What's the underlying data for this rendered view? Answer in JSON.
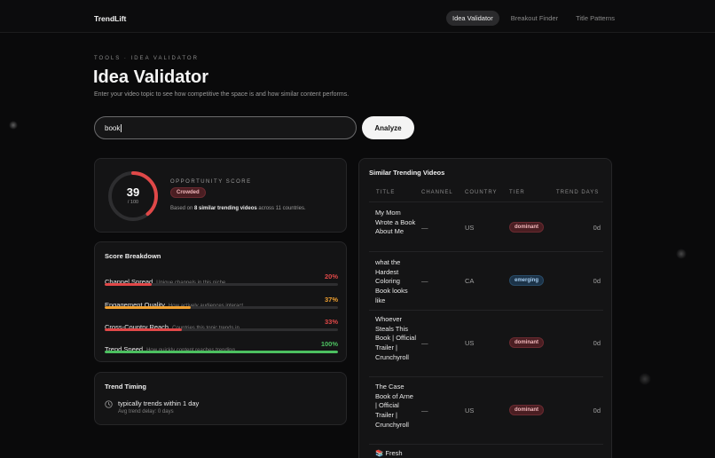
{
  "app": {
    "brand": "TrendLift"
  },
  "nav": {
    "items": [
      "Idea Validator",
      "Breakout Finder",
      "Title Patterns"
    ]
  },
  "header": {
    "breadcrumb": "TOOLS · IDEA VALIDATOR",
    "title": "Idea Validator",
    "subtitle": "Enter your video topic to see how competitive the space is and how similar content performs."
  },
  "search": {
    "value": "book",
    "button_label": "Analyze"
  },
  "score": {
    "value": 39,
    "denominator": "/ 100",
    "label": "OPPORTUNITY SCORE",
    "status": "Crowded",
    "based_prefix": "Based on ",
    "based_bold": "8 similar trending videos",
    "based_suffix": " across 11 countries.",
    "color": "#e04848"
  },
  "breakdown": {
    "title": "Score Breakdown",
    "metrics": [
      {
        "name": "Channel Spread",
        "desc": "Unique channels in this niche",
        "pct": "20%",
        "fraction": 0.2,
        "color": "#e04848"
      },
      {
        "name": "Engagement Quality",
        "desc": "How actively audiences interact",
        "pct": "37%",
        "fraction": 0.37,
        "color": "#f0a030"
      },
      {
        "name": "Cross-Country Reach",
        "desc": "Countries this topic trends in",
        "pct": "33%",
        "fraction": 0.33,
        "color": "#e04848"
      },
      {
        "name": "Trend Speed",
        "desc": "How quickly content reaches trending",
        "pct": "100%",
        "fraction": 1.0,
        "color": "#4cc060"
      }
    ]
  },
  "timing": {
    "title": "Trend Timing",
    "main": "typically trends within 1 day",
    "sub": "Avg trend delay: 0 days"
  },
  "similar": {
    "title": "Similar Trending Videos",
    "columns": [
      "TITLE",
      "CHANNEL",
      "COUNTRY",
      "TIER",
      "TREND DAYS"
    ],
    "rows": [
      {
        "title": "My Mom Wrote a Book About Me",
        "channel": "—",
        "country": "US",
        "tier": "dominant",
        "days": "0d"
      },
      {
        "title": "what the Hardest Coloring Book looks like",
        "channel": "—",
        "country": "CA",
        "tier": "emerging",
        "days": "0d"
      },
      {
        "title": "Whoever Steals This Book | Official Trailer | Crunchyroll",
        "channel": "—",
        "country": "US",
        "tier": "dominant",
        "days": "0d"
      },
      {
        "title": "The Case Book of Arne | Official Trailer | Crunchyroll",
        "channel": "—",
        "country": "US",
        "tier": "dominant",
        "days": "0d"
      }
    ],
    "partial_row": "📚 Fresh"
  }
}
